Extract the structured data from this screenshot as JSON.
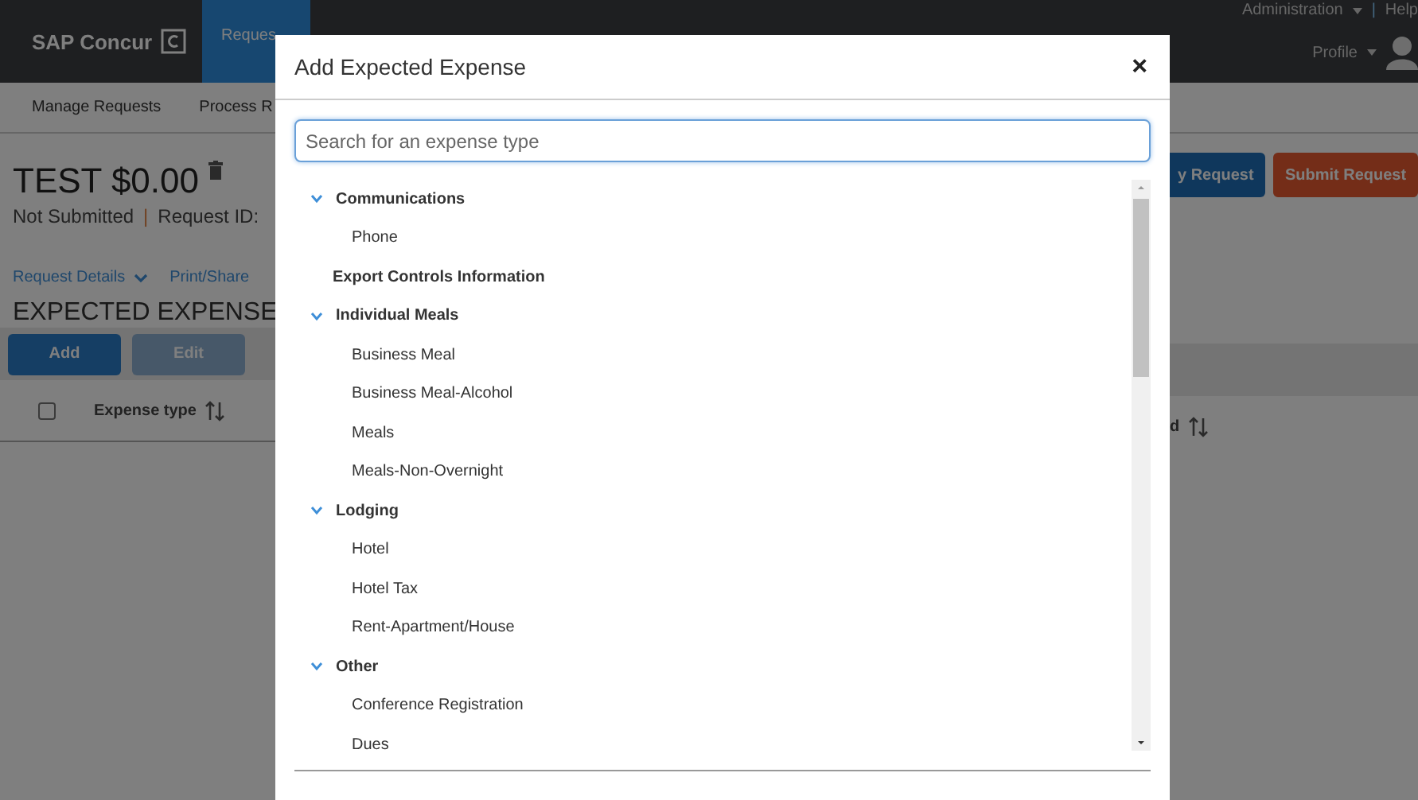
{
  "nav": {
    "logo": "SAP Concur",
    "tab": "Reques",
    "admin": "Administration",
    "separator": "|",
    "help": "Help",
    "profile": "Profile"
  },
  "subnav": [
    "Manage Requests",
    "Process R"
  ],
  "request": {
    "title": "TEST $0.00",
    "status": "Not Submitted",
    "separator": "|",
    "id_label": "Request ID:",
    "links": [
      "Request Details",
      "Print/Share"
    ],
    "section": "EXPECTED EXPENSE"
  },
  "toolbar": [
    {
      "label": "Add",
      "disabled": false
    },
    {
      "label": "Edit",
      "disabled": true
    }
  ],
  "right_buttons": [
    {
      "label": "y Request",
      "kind": "primary"
    },
    {
      "label": "Submit Request",
      "kind": "danger"
    }
  ],
  "table": {
    "columns": [
      "Expense type",
      "d"
    ],
    "select_all": {
      "checked": false
    }
  },
  "dialog": {
    "title": "Add Expected Expense",
    "close": "×",
    "search": {
      "placeholder": "Search for an expense type"
    },
    "items": [
      {
        "label": "Communications",
        "expanded": true,
        "children": [
          {
            "label": "Phone"
          }
        ]
      },
      {
        "label": "Export Controls Information"
      },
      {
        "label": "Individual Meals",
        "expanded": true,
        "children": [
          {
            "label": "Business Meal"
          },
          {
            "label": "Business Meal-Alcohol"
          },
          {
            "label": "Meals"
          },
          {
            "label": "Meals-Non-Overnight"
          }
        ]
      },
      {
        "label": "Lodging",
        "expanded": true,
        "children": [
          {
            "label": "Hotel"
          },
          {
            "label": "Hotel Tax"
          },
          {
            "label": "Rent-Apartment/House"
          }
        ]
      },
      {
        "label": "Other",
        "expanded": true,
        "children": [
          {
            "label": "Conference Registration"
          },
          {
            "label": "Dues"
          }
        ]
      }
    ]
  }
}
